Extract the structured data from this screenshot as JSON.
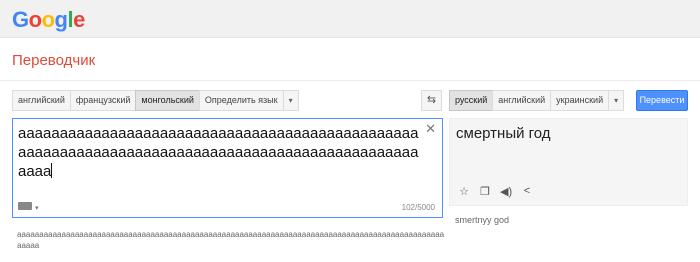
{
  "logo": {
    "letters": [
      "G",
      "o",
      "o",
      "g",
      "l",
      "e"
    ],
    "colors": [
      "#4285f4",
      "#ea4335",
      "#fbbc05",
      "#4285f4",
      "#34a853",
      "#ea4335"
    ]
  },
  "app_title": "Переводчик",
  "source_languages": {
    "items": [
      "английский",
      "французский",
      "монгольский",
      "Определить язык"
    ],
    "active_index": 2
  },
  "target_languages": {
    "items": [
      "русский",
      "английский",
      "украинский"
    ],
    "active_index": 0
  },
  "translate_button": "Перевести",
  "swap_icon": "swap-arrows-icon",
  "source": {
    "text": "aaaaaaaaaaaaaaaaaaaaaaaaaaaaaaaaaaaaaaaaaaaaaaaaaaaaaaaaaaaaaaaaaaaaaaaaaaaaaaaaaaaaaaaaaaaaaaaaaaaa",
    "counter": "102/5000",
    "transliteration": "aaaaaaaaaaaaaaaaaaaaaaaaaaaaaaaaaaaaaaaaaaaaaaaaaaaaaaaaaaaaaaaaaaaaaaaaaaaaaaaaaaaaaaaaaaaaaaaaaaaaa"
  },
  "target": {
    "text": "смертный год",
    "transliteration": "smertnyy god",
    "icons": [
      "star-icon",
      "copy-icon",
      "speaker-icon",
      "share-icon"
    ]
  },
  "accent_color": "#4d90fe",
  "title_color": "#dd4b39"
}
